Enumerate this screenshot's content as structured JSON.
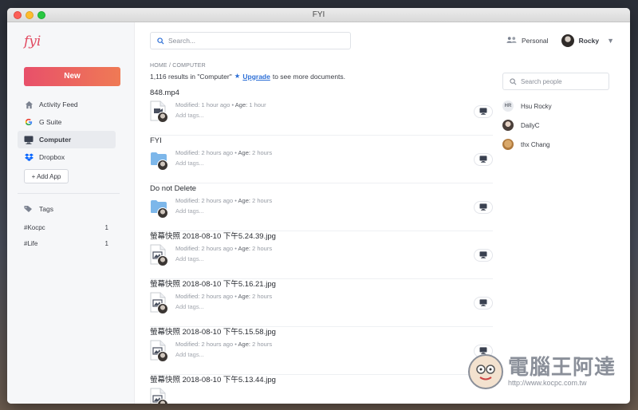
{
  "window": {
    "title": "FYI"
  },
  "sidebar": {
    "logo": "fyi",
    "new_label": "New",
    "items": [
      {
        "label": "Activity Feed",
        "icon": "home-icon",
        "active": false
      },
      {
        "label": "G Suite",
        "icon": "google-icon",
        "active": false
      },
      {
        "label": "Computer",
        "icon": "monitor-icon",
        "active": true
      },
      {
        "label": "Dropbox",
        "icon": "dropbox-icon",
        "active": false
      }
    ],
    "add_app_label": "+ Add App",
    "tags_label": "Tags",
    "tags": [
      {
        "name": "#Kocpc",
        "count": "1"
      },
      {
        "name": "#Life",
        "count": "1"
      }
    ]
  },
  "main": {
    "search_placeholder": "Search...",
    "breadcrumb": "HOME / COMPUTER",
    "results_text": "1,116 results in \"Computer\"",
    "upgrade_label": "Upgrade",
    "upgrade_suffix": "to see more documents.",
    "documents": [
      {
        "name": "848.mp4",
        "kind": "video",
        "modified": "1 hour ago",
        "age": "1 hour",
        "tags_placeholder": "Add tags..."
      },
      {
        "name": "FYI",
        "kind": "folder",
        "modified": "2 hours ago",
        "age": "2 hours",
        "tags_placeholder": "Add tags..."
      },
      {
        "name": "Do not Delete",
        "kind": "folder",
        "modified": "2 hours ago",
        "age": "2 hours",
        "tags_placeholder": "Add tags..."
      },
      {
        "name": "螢幕快照 2018-08-10 下午5.24.39.jpg",
        "kind": "image",
        "modified": "2 hours ago",
        "age": "2 hours",
        "tags_placeholder": "Add tags..."
      },
      {
        "name": "螢幕快照 2018-08-10 下午5.16.21.jpg",
        "kind": "image",
        "modified": "2 hours ago",
        "age": "2 hours",
        "tags_placeholder": "Add tags..."
      },
      {
        "name": "螢幕快照 2018-08-10 下午5.15.58.jpg",
        "kind": "image",
        "modified": "2 hours ago",
        "age": "2 hours",
        "tags_placeholder": "Add tags..."
      },
      {
        "name": "螢幕快照 2018-08-10 下午5.13.44.jpg",
        "kind": "image",
        "modified": "",
        "age": "",
        "tags_placeholder": ""
      }
    ],
    "modified_label": "Modified:",
    "age_label": "Age:"
  },
  "right": {
    "workspace_label": "Personal",
    "user_name": "Rocky",
    "people_search_placeholder": "Search people",
    "people": [
      {
        "name": "Hsu Rocky",
        "initials": "HR",
        "avatar": "initials"
      },
      {
        "name": "DailyC",
        "initials": "",
        "avatar": "photo"
      },
      {
        "name": "thx Chang",
        "initials": "",
        "avatar": "dog"
      }
    ]
  },
  "watermark": {
    "title": "電腦王阿達",
    "url": "http://www.kocpc.com.tw"
  },
  "colors": {
    "accent": "#e8506a",
    "link": "#2d6fd6",
    "sidebar_bg": "#f6f7f9"
  }
}
